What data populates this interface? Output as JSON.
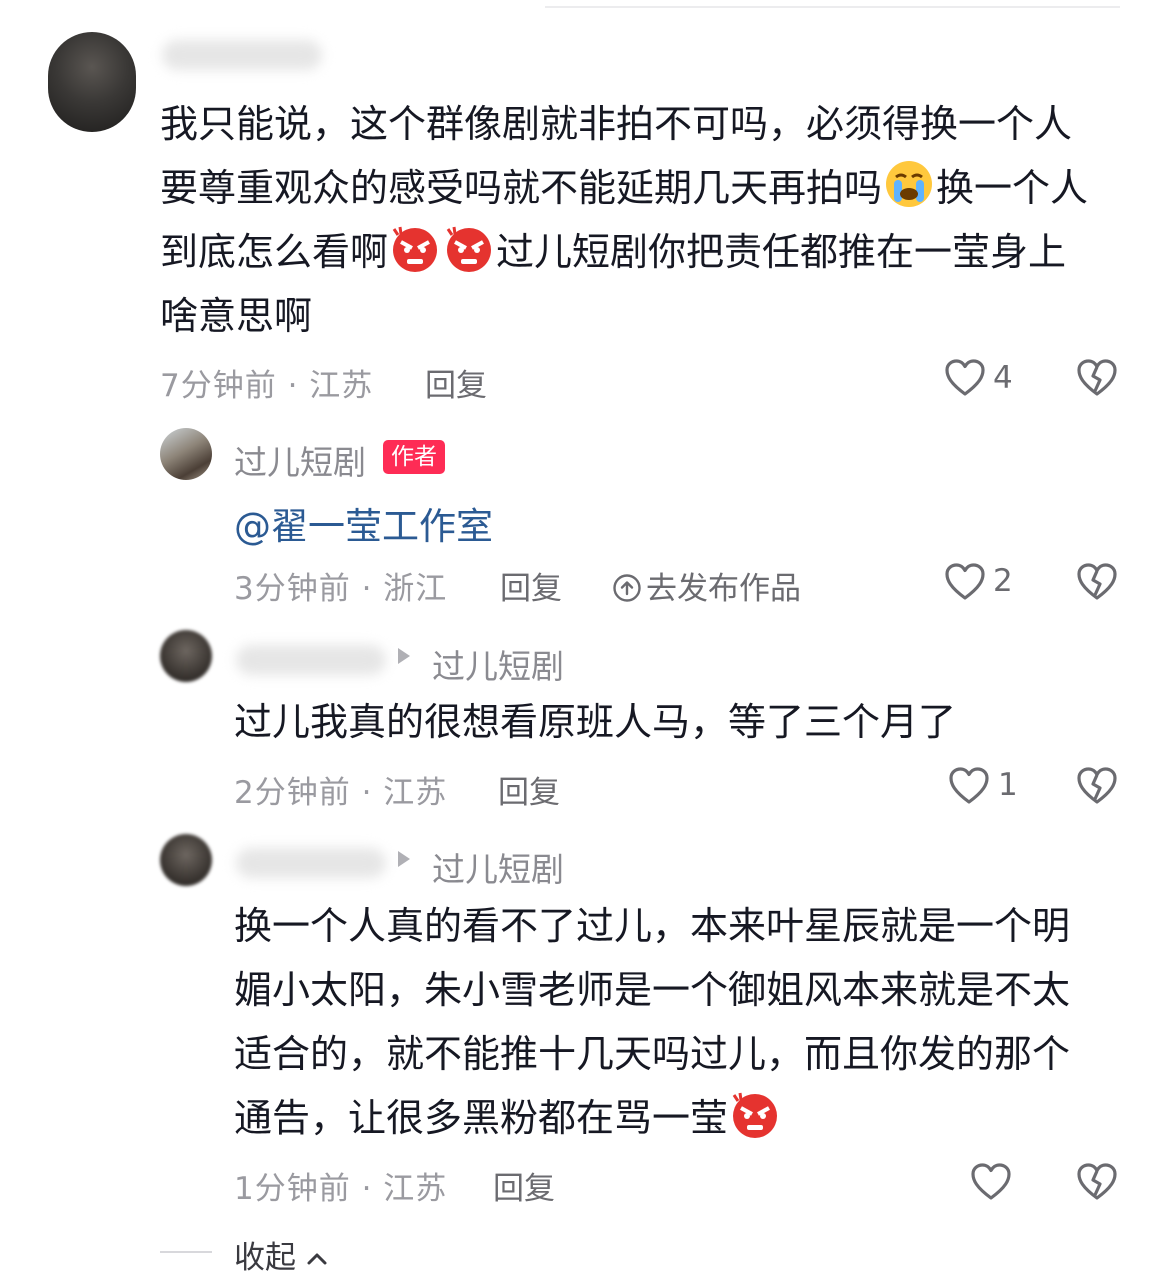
{
  "comments": [
    {
      "text_lines": [
        "我只能说，这个群像剧就非拍不可吗，必须得换一个人",
        "要尊重观众的感受吗就不能延期几天再拍吗",
        "换一个人",
        "到底怎么看啊",
        "过儿短剧你把责任都推在一莹身上",
        "啥意思啊"
      ],
      "meta": "7分钟前 · 江苏",
      "reply": "回复",
      "likes": "4"
    }
  ],
  "author_reply": {
    "nickname": "过儿短剧",
    "badge": "作者",
    "mention": "@翟一莹工作室",
    "meta": "3分钟前 · 浙江",
    "reply": "回复",
    "publish": "去发布作品",
    "likes": "2"
  },
  "reply2": {
    "target": "过儿短剧",
    "text": "过儿我真的很想看原班人马，等了三个月了",
    "meta": "2分钟前 · 江苏",
    "reply": "回复",
    "likes": "1"
  },
  "reply3": {
    "target": "过儿短剧",
    "text_lines": [
      "换一个人真的看不了过儿，本来叶星辰就是一个明",
      "媚小太阳，朱小雪老师是一个御姐风本来就是不太",
      "适合的，就不能推十几天吗过儿，而且你发的那个",
      "通告，让很多黑粉都在骂一莹"
    ],
    "meta": "1分钟前 · 江苏",
    "reply": "回复"
  },
  "collapse_label": "收起",
  "icons": {
    "like": "heart-outline-icon",
    "dislike": "broken-heart-icon",
    "emoji_cry": "loudly-crying-face-emoji",
    "emoji_angry": "angry-face-emoji",
    "publish": "upload-circle-icon"
  },
  "colors": {
    "badge": "#fe2c55",
    "mention": "#2b5a93",
    "meta": "#9a9aa0"
  }
}
